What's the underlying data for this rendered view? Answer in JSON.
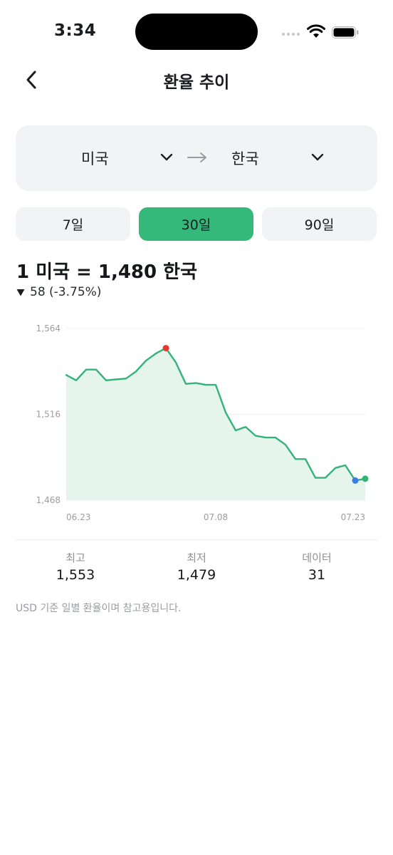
{
  "status_bar": {
    "time": "3:34"
  },
  "header": {
    "title": "환율 추이"
  },
  "currency": {
    "from": "미국",
    "to": "한국"
  },
  "periods": [
    {
      "label": "7일",
      "active": false
    },
    {
      "label": "30일",
      "active": true
    },
    {
      "label": "90일",
      "active": false
    }
  ],
  "rate": {
    "summary": "1 미국 = 1,480 한국",
    "change": "58 (-3.75%)",
    "direction": "down"
  },
  "colors": {
    "accent": "#35b97a",
    "line": "#34b27a",
    "area": "#e5f5ec",
    "max_marker": "#e53935",
    "min_marker": "#3b7be8",
    "last_marker": "#34b27a"
  },
  "chart_data": {
    "type": "area",
    "x_tick_labels": [
      "06.23",
      "07.08",
      "07.23"
    ],
    "y_tick_labels": [
      "1,564",
      "1,516",
      "1,468"
    ],
    "ylim": [
      1468,
      1564
    ],
    "grid": "horizontal",
    "values": [
      1538,
      1535,
      1541,
      1541,
      1535,
      1535.5,
      1536,
      1540,
      1546,
      1550,
      1553,
      1545,
      1533,
      1533.5,
      1532.5,
      1532.5,
      1517,
      1507,
      1509,
      1504,
      1503,
      1503,
      1499,
      1491,
      1491,
      1480.5,
      1480.5,
      1486,
      1487.5,
      1479,
      1480
    ],
    "markers": [
      {
        "type": "max",
        "index": 10
      },
      {
        "type": "min",
        "index": 29
      },
      {
        "type": "last",
        "index": 30
      }
    ]
  },
  "stats": {
    "high_label": "최고",
    "high_value": "1,553",
    "low_label": "최저",
    "low_value": "1,479",
    "count_label": "데이터",
    "count_value": "31"
  },
  "footnote": "USD 기준 일별 환율이며 참고용입니다."
}
